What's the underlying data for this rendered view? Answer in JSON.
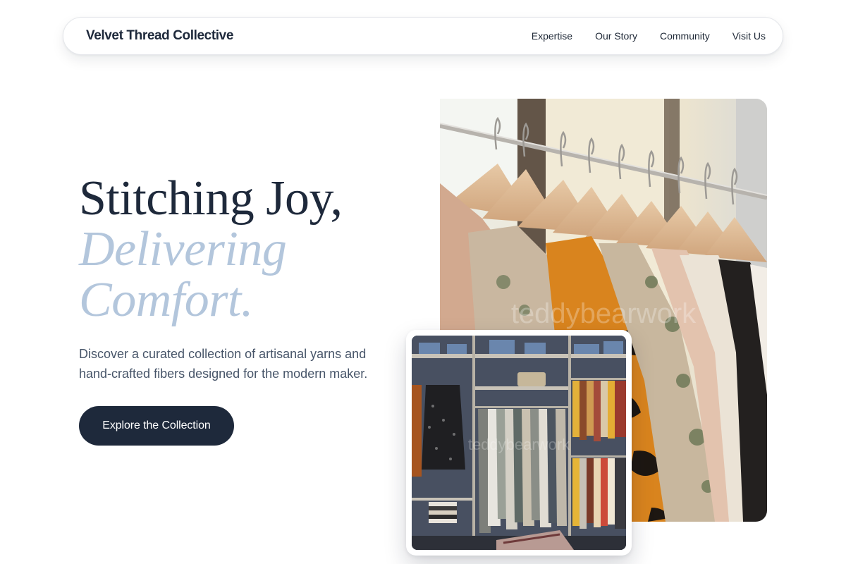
{
  "brand": {
    "name": "Velvet Thread Collective"
  },
  "nav": {
    "links": [
      "Expertise",
      "Our Story",
      "Community",
      "Visit Us"
    ]
  },
  "hero": {
    "line1": "Stitching Joy,",
    "line2a": "Delivering",
    "line2b": "Comfort.",
    "subtitle": "Discover a curated collection of artisanal yarns and hand-crafted fibers designed for the modern maker.",
    "cta_label": "Explore the Collection"
  },
  "images": {
    "main_alt": "Clothing rack with hangers",
    "secondary_alt": "Boutique shelving with dresses"
  },
  "colors": {
    "primary": "#1e293b",
    "accent_italic": "#b3c6dc",
    "body_text": "#475569"
  }
}
